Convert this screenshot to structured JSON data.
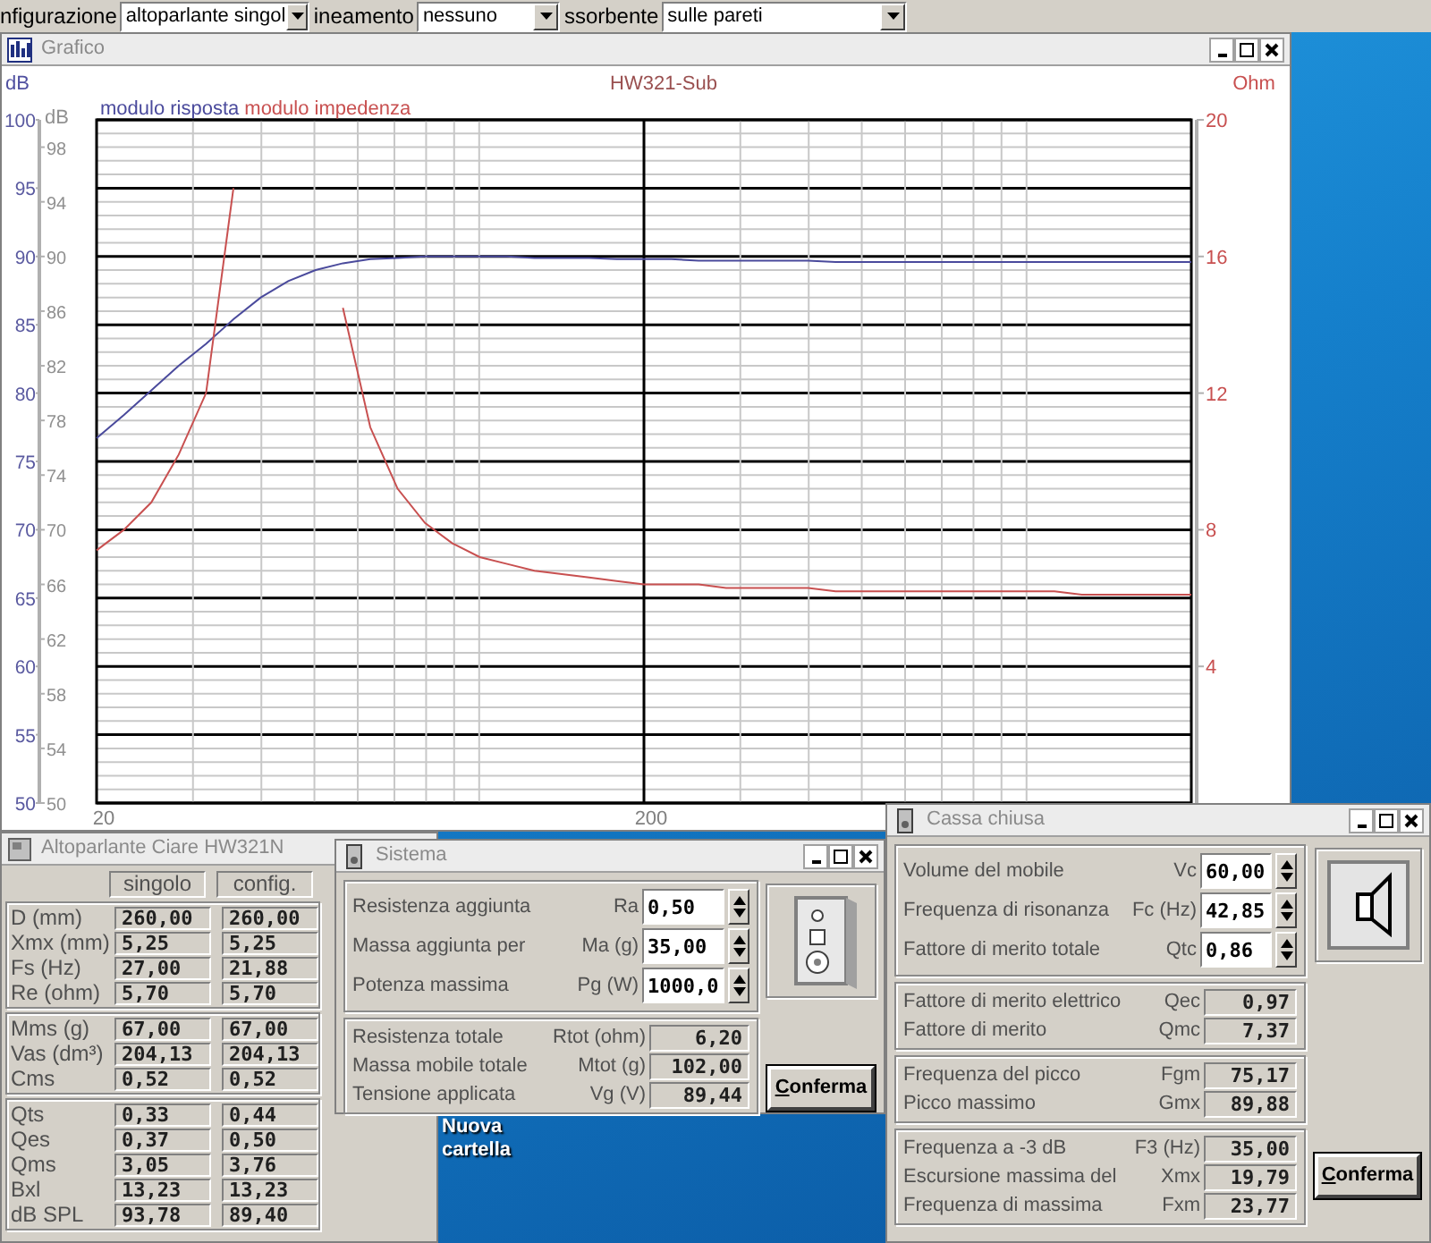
{
  "toolbar": {
    "fields": [
      {
        "label": "nfigurazione",
        "value": "altoparlante singol"
      },
      {
        "label": "ineamento",
        "value": "nessuno"
      },
      {
        "label": "ssorbente",
        "value": "sulle pareti"
      }
    ]
  },
  "graph_window": {
    "title": "Grafico",
    "inner_axis": {
      "label": "dB",
      "ticks": [
        "98",
        "94",
        "90",
        "86",
        "82",
        "78",
        "74",
        "70",
        "66",
        "62",
        "58",
        "54",
        "50"
      ]
    },
    "chart_data": {
      "type": "line",
      "title": "HW321-Sub",
      "ylabel": "dB",
      "y2label": "Ohm",
      "grid": true,
      "categories": [
        "20",
        null,
        null,
        null,
        null,
        null,
        null,
        null,
        null,
        null,
        null,
        null,
        null,
        null,
        null,
        null,
        null,
        null,
        null,
        null,
        "200",
        null,
        null,
        null,
        null,
        null,
        null,
        null,
        null,
        null,
        null,
        null,
        null,
        null,
        null,
        null,
        null,
        null,
        null,
        null,
        null
      ],
      "ylim": [
        50,
        100
      ],
      "yticks": [
        100,
        95,
        90,
        85,
        80,
        75,
        70,
        65,
        60,
        55,
        50
      ],
      "y2lim": [
        0,
        20
      ],
      "y2ticks": [
        20,
        16,
        12,
        8,
        4
      ],
      "series": [
        {
          "name": "modulo risposta",
          "color": "#4a4a9c",
          "values": [
            76.7,
            78.4,
            80.2,
            82,
            83.6,
            85.4,
            87,
            88.2,
            89,
            89.5,
            89.8,
            89.9,
            90,
            90,
            90,
            90,
            89.9,
            89.9,
            89.9,
            89.8,
            89.8,
            89.8,
            89.7,
            89.7,
            89.7,
            89.7,
            89.7,
            89.6,
            89.6,
            89.6,
            89.6,
            89.6,
            89.6,
            89.6,
            89.6,
            89.6,
            89.6,
            89.6,
            89.6,
            89.6,
            89.6
          ]
        },
        {
          "name": "modulo impedenza",
          "color": "#c85050",
          "axis": "y2",
          "values": [
            7.4,
            8,
            8.8,
            10.2,
            12,
            18,
            null,
            null,
            null,
            14.5,
            11,
            9.2,
            8.2,
            7.6,
            7.2,
            7,
            6.8,
            6.7,
            6.6,
            6.5,
            6.4,
            6.4,
            6.4,
            6.3,
            6.3,
            6.3,
            6.3,
            6.2,
            6.2,
            6.2,
            6.2,
            6.2,
            6.2,
            6.2,
            6.2,
            6.2,
            6.1,
            6.1,
            6.1,
            6.1,
            6.1
          ]
        }
      ]
    }
  },
  "speaker_window": {
    "title": "Altoparlante Ciare HW321N",
    "columns": [
      "singolo",
      "config."
    ],
    "groups": [
      [
        {
          "label": "D (mm)",
          "values": [
            "260,00",
            "260,00"
          ]
        },
        {
          "label": "Xmx (mm)",
          "values": [
            "5,25",
            "5,25"
          ]
        },
        {
          "label": "Fs (Hz)",
          "values": [
            "27,00",
            "21,88"
          ]
        },
        {
          "label": "Re (ohm)",
          "values": [
            "5,70",
            "5,70"
          ]
        }
      ],
      [
        {
          "label": "Mms (g)",
          "values": [
            "67,00",
            "67,00"
          ]
        },
        {
          "label": "Vas (dm³)",
          "values": [
            "204,13",
            "204,13"
          ]
        },
        {
          "label": "Cms",
          "values": [
            "0,52",
            "0,52"
          ]
        }
      ],
      [
        {
          "label": "Qts",
          "values": [
            "0,33",
            "0,44"
          ]
        },
        {
          "label": "Qes",
          "values": [
            "0,37",
            "0,50"
          ]
        },
        {
          "label": "Qms",
          "values": [
            "3,05",
            "3,76"
          ]
        },
        {
          "label": "Bxl",
          "values": [
            "13,23",
            "13,23"
          ]
        },
        {
          "label": "dB SPL",
          "values": [
            "93,78",
            "89,40"
          ]
        }
      ]
    ]
  },
  "desktop_icons": [
    {
      "label": "Nuova cartella"
    }
  ],
  "system_window": {
    "title": "Sistema",
    "inputs": [
      {
        "label": "Resistenza aggiunta",
        "symbol": "Ra",
        "value": "0,50"
      },
      {
        "label": "Massa aggiunta per",
        "symbol": "Ma (g)",
        "value": "35,00"
      },
      {
        "label": "Potenza massima",
        "symbol": "Pg (W)",
        "value": "1000,0"
      }
    ],
    "output_groups": [
      [
        {
          "label": "Resistenza totale",
          "symbol": "Rtot (ohm)",
          "value": "6,20"
        },
        {
          "label": "Massa mobile totale",
          "symbol": "Mtot (g)",
          "value": "102,00"
        },
        {
          "label": "Tensione applicata",
          "symbol": "Vg (V)",
          "value": "89,44"
        }
      ]
    ],
    "button": "Conferma"
  },
  "box_window": {
    "title": "Cassa chiusa",
    "inputs": [
      {
        "label": "Volume del mobile",
        "symbol": "Vc",
        "value": "60,00"
      },
      {
        "label": "Frequenza di risonanza",
        "symbol": "Fc (Hz)",
        "value": "42,85"
      },
      {
        "label": "Fattore di merito totale",
        "symbol": "Qtc",
        "value": "0,86"
      }
    ],
    "output_groups": [
      [
        {
          "label": "Fattore di merito elettrico",
          "symbol": "Qec",
          "value": "0,97"
        },
        {
          "label": "Fattore di merito",
          "symbol": "Qmc",
          "value": "7,37"
        }
      ],
      [
        {
          "label": "Frequenza del picco",
          "symbol": "Fgm",
          "value": "75,17"
        },
        {
          "label": "Picco massimo",
          "symbol": "Gmx",
          "value": "89,88"
        }
      ],
      [
        {
          "label": "Frequenza a -3 dB",
          "symbol": "F3 (Hz)",
          "value": "35,00"
        },
        {
          "label": "Escursione massima del",
          "symbol": "Xmx",
          "value": "19,79"
        },
        {
          "label": "Frequenza di massima",
          "symbol": "Fxm",
          "value": "23,77"
        }
      ]
    ],
    "button": "Conferma"
  }
}
